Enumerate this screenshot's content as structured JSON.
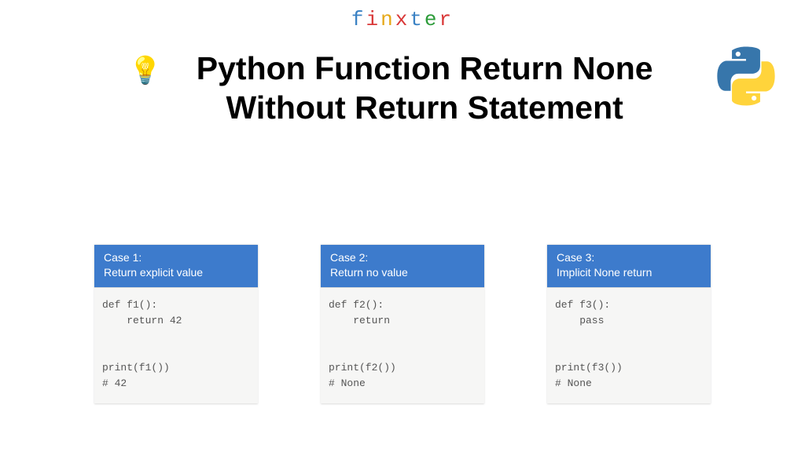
{
  "brand": "finxter",
  "title": "Python Function Return None Without Return Statement",
  "cases": [
    {
      "number": "Case 1",
      "desc": "Return explicit value",
      "code": "def f1():\n    return 42\n\n\nprint(f1())\n# 42"
    },
    {
      "number": "Case 2",
      "desc": "Return no value",
      "code": "def f2():\n    return\n\n\nprint(f2())\n# None"
    },
    {
      "number": "Case 3",
      "desc": "Implicit None return",
      "code": "def f3():\n    pass\n\n\nprint(f3())\n# None"
    }
  ]
}
